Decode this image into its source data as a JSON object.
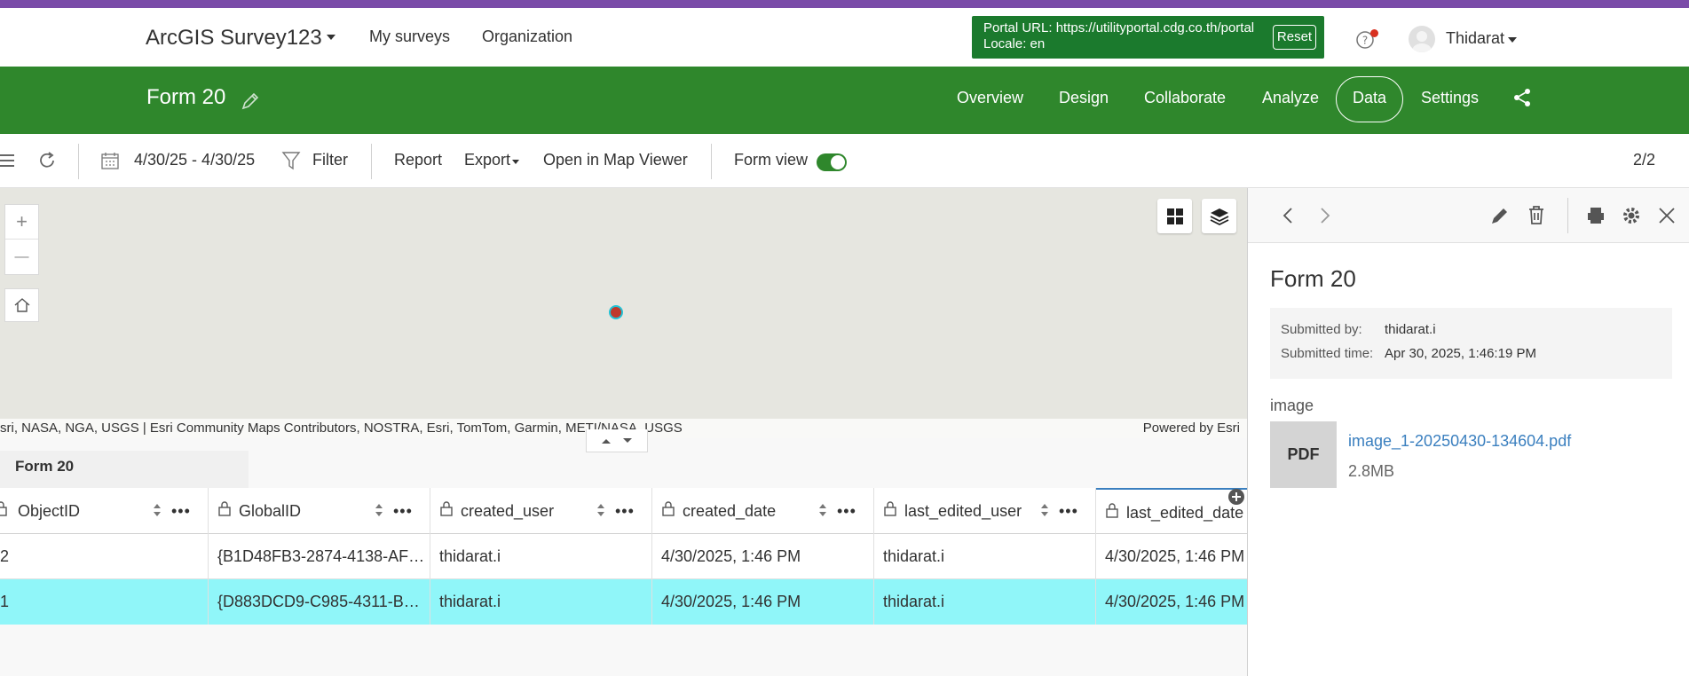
{
  "header": {
    "app_title": "ArcGIS Survey123",
    "nav": [
      "My surveys",
      "Organization"
    ],
    "portal_line1": "Portal URL: https://utilityportal.cdg.co.th/portal",
    "portal_line2": "Locale: en",
    "reset_label": "Reset",
    "user_name": "Thidarat"
  },
  "survey": {
    "title": "Form 20",
    "tabs": [
      "Overview",
      "Design",
      "Collaborate",
      "Analyze",
      "Data",
      "Settings"
    ],
    "active_tab": "Data"
  },
  "toolbar": {
    "date_range": "4/30/25 - 4/30/25",
    "filter_label": "Filter",
    "report_label": "Report",
    "export_label": "Export",
    "map_viewer_label": "Open in Map Viewer",
    "form_view_label": "Form view",
    "form_view_on": true,
    "page_count": "2/2"
  },
  "map": {
    "attribution": "sri, NASA, NGA, USGS | Esri Community Maps Contributors, NOSTRA, Esri, TomTom, Garmin, METI/NASA, USGS",
    "powered_by": "Powered by Esri",
    "zoom_in": "+",
    "zoom_out": "—"
  },
  "table": {
    "tab_label": "Form 20",
    "columns": [
      "ObjectID",
      "GlobalID",
      "created_user",
      "created_date",
      "last_edited_user",
      "last_edited_date"
    ],
    "rows": [
      {
        "cells": [
          "2",
          "{B1D48FB3-2874-4138-AF…",
          "thidarat.i",
          "4/30/2025, 1:46 PM",
          "thidarat.i",
          "4/30/2025, 1:46 PM"
        ],
        "selected": false
      },
      {
        "cells": [
          "1",
          "{D883DCD9-C985-4311-B…",
          "thidarat.i",
          "4/30/2025, 1:46 PM",
          "thidarat.i",
          "4/30/2025, 1:46 PM"
        ],
        "selected": true
      }
    ],
    "selected_color": "#90f6f9"
  },
  "panel": {
    "title": "Form 20",
    "submitted_by_label": "Submitted by:",
    "submitted_by": "thidarat.i",
    "submitted_time_label": "Submitted time:",
    "submitted_time": "Apr 30, 2025, 1:46:19 PM",
    "field_label": "image",
    "file_type": "PDF",
    "file_name": "image_1-20250430-134604.pdf",
    "file_size": "2.8MB"
  },
  "colors": {
    "brand_green": "#2f872c",
    "top_stripe": "#7a4ba8",
    "link_blue": "#3a7fbf"
  }
}
